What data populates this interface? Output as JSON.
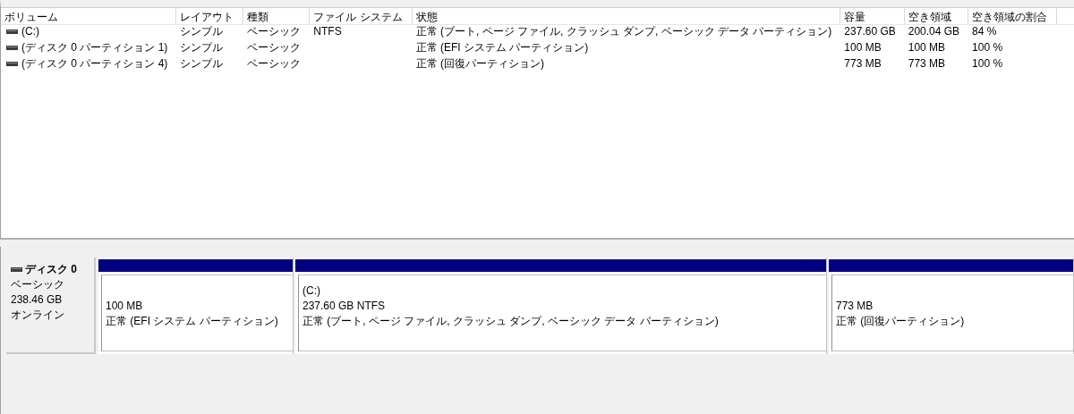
{
  "volume_list": {
    "columns": [
      "ボリューム",
      "レイアウト",
      "種類",
      "ファイル システム",
      "状態",
      "容量",
      "空き領域",
      "空き領域の割合"
    ],
    "rows": [
      {
        "cells": [
          "(C:)",
          "シンプル",
          "ベーシック",
          "NTFS",
          "正常 (ブート, ページ ファイル, クラッシュ ダンプ, ベーシック データ パーティション)",
          "237.60 GB",
          "200.04 GB",
          "84 %"
        ]
      },
      {
        "cells": [
          "(ディスク 0 パーティション 1)",
          "シンプル",
          "ベーシック",
          "",
          "正常 (EFI システム パーティション)",
          "100 MB",
          "100 MB",
          "100 %"
        ]
      },
      {
        "cells": [
          "(ディスク 0 パーティション 4)",
          "シンプル",
          "ベーシック",
          "",
          "正常 (回復パーティション)",
          "773 MB",
          "773 MB",
          "100 %"
        ]
      }
    ]
  },
  "disk": {
    "name": "ディスク 0",
    "type": "ベーシック",
    "size": "238.46 GB",
    "status": "オンライン",
    "partitions": [
      {
        "size": "100 MB",
        "status": "正常 (EFI システム パーティション)"
      },
      {
        "label": "(C:)",
        "size": "237.60 GB NTFS",
        "status": "正常 (ブート, ページ ファイル, クラッシュ ダンプ, ベーシック データ パーティション)"
      },
      {
        "size": "773 MB",
        "status": "正常 (回復パーティション)"
      }
    ]
  }
}
